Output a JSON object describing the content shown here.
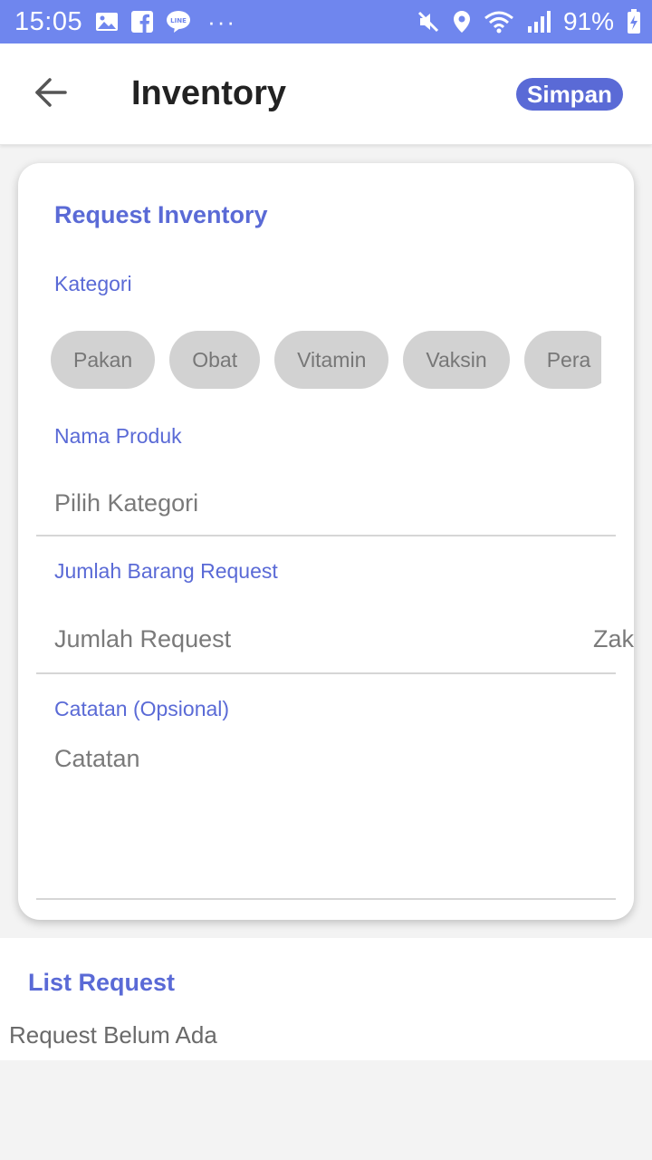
{
  "status_bar": {
    "time": "15:05",
    "battery": "91%",
    "more": "···",
    "icons": [
      "image-icon",
      "facebook-icon",
      "line-icon",
      "mute-icon",
      "location-icon",
      "wifi-icon",
      "signal-icon",
      "battery-charging-icon"
    ]
  },
  "header": {
    "title": "Inventory",
    "save_label": "Simpan",
    "back_icon": "arrow-left-icon"
  },
  "form": {
    "title": "Request Inventory",
    "category_label": "Kategori",
    "categories": [
      "Pakan",
      "Obat",
      "Vitamin",
      "Vaksin",
      "Pera"
    ],
    "product_label": "Nama Produk",
    "product_placeholder": "Pilih Kategori",
    "quantity_label": "Jumlah Barang Request",
    "quantity_placeholder": "Jumlah Request",
    "quantity_unit": "Zak",
    "notes_label": "Catatan (Opsional)",
    "notes_placeholder": "Catatan"
  },
  "list": {
    "title": "List Request",
    "empty_text": "Request Belum Ada"
  },
  "colors": {
    "status_bar": "#6f86ee",
    "accent": "#5a6ad6",
    "chip_bg": "#d2d2d2"
  }
}
